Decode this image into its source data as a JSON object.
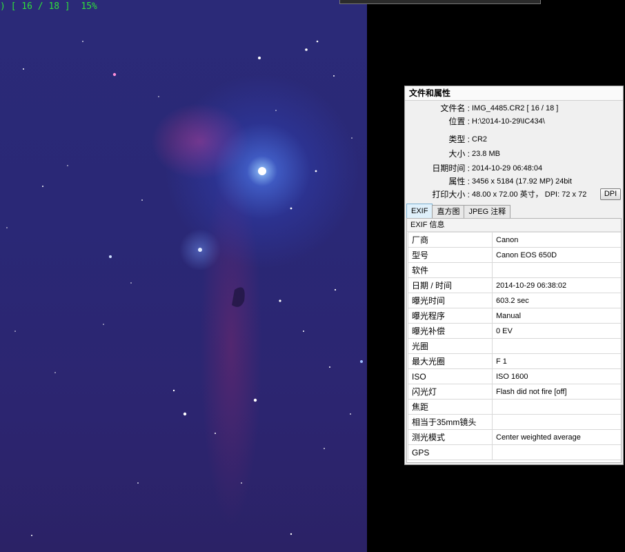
{
  "viewer": {
    "status_text": ") [ 16 / 18 ]  15%"
  },
  "props": {
    "title": "文件和属性",
    "info": [
      {
        "label": "文件名 :",
        "value": "IMG_4485.CR2   [ 16 / 18 ]"
      },
      {
        "label": "位置 :",
        "value": "H:\\2014-10-29\\IC434\\"
      },
      {
        "label": "类型 :",
        "value": "CR2"
      },
      {
        "label": "大小 :",
        "value": "23.8 MB"
      },
      {
        "label": "日期时间 :",
        "value": "2014-10-29 06:48:04"
      },
      {
        "label": "属性 :",
        "value": "3456 x 5184 (17.92 MP)  24bit"
      },
      {
        "label": "打印大小 :",
        "value": "48.00 x 72.00 英寸，  DPI: 72 x 72"
      }
    ],
    "dpi_label": "DPI",
    "tabs": [
      "EXIF",
      "直方图",
      "JPEG 注释"
    ],
    "exif_header": "EXIF 信息",
    "exif_rows": [
      {
        "key": "厂商",
        "value": "Canon"
      },
      {
        "key": "型号",
        "value": "Canon EOS 650D"
      },
      {
        "key": "软件",
        "value": ""
      },
      {
        "key": "日期 / 时间",
        "value": "2014-10-29 06:38:02"
      },
      {
        "key": "曝光时间",
        "value": "603.2 sec"
      },
      {
        "key": "曝光程序",
        "value": "Manual"
      },
      {
        "key": "曝光补偿",
        "value": "0 EV"
      },
      {
        "key": "光圈",
        "value": ""
      },
      {
        "key": "最大光圈",
        "value": "F 1"
      },
      {
        "key": "ISO",
        "value": "ISO 1600"
      },
      {
        "key": "闪光灯",
        "value": "Flash did not fire [off]"
      },
      {
        "key": "焦距",
        "value": ""
      },
      {
        "key": "相当于35mm镜头",
        "value": ""
      },
      {
        "key": "测光模式",
        "value": "Center weighted average"
      },
      {
        "key": "GPS",
        "value": ""
      }
    ]
  }
}
